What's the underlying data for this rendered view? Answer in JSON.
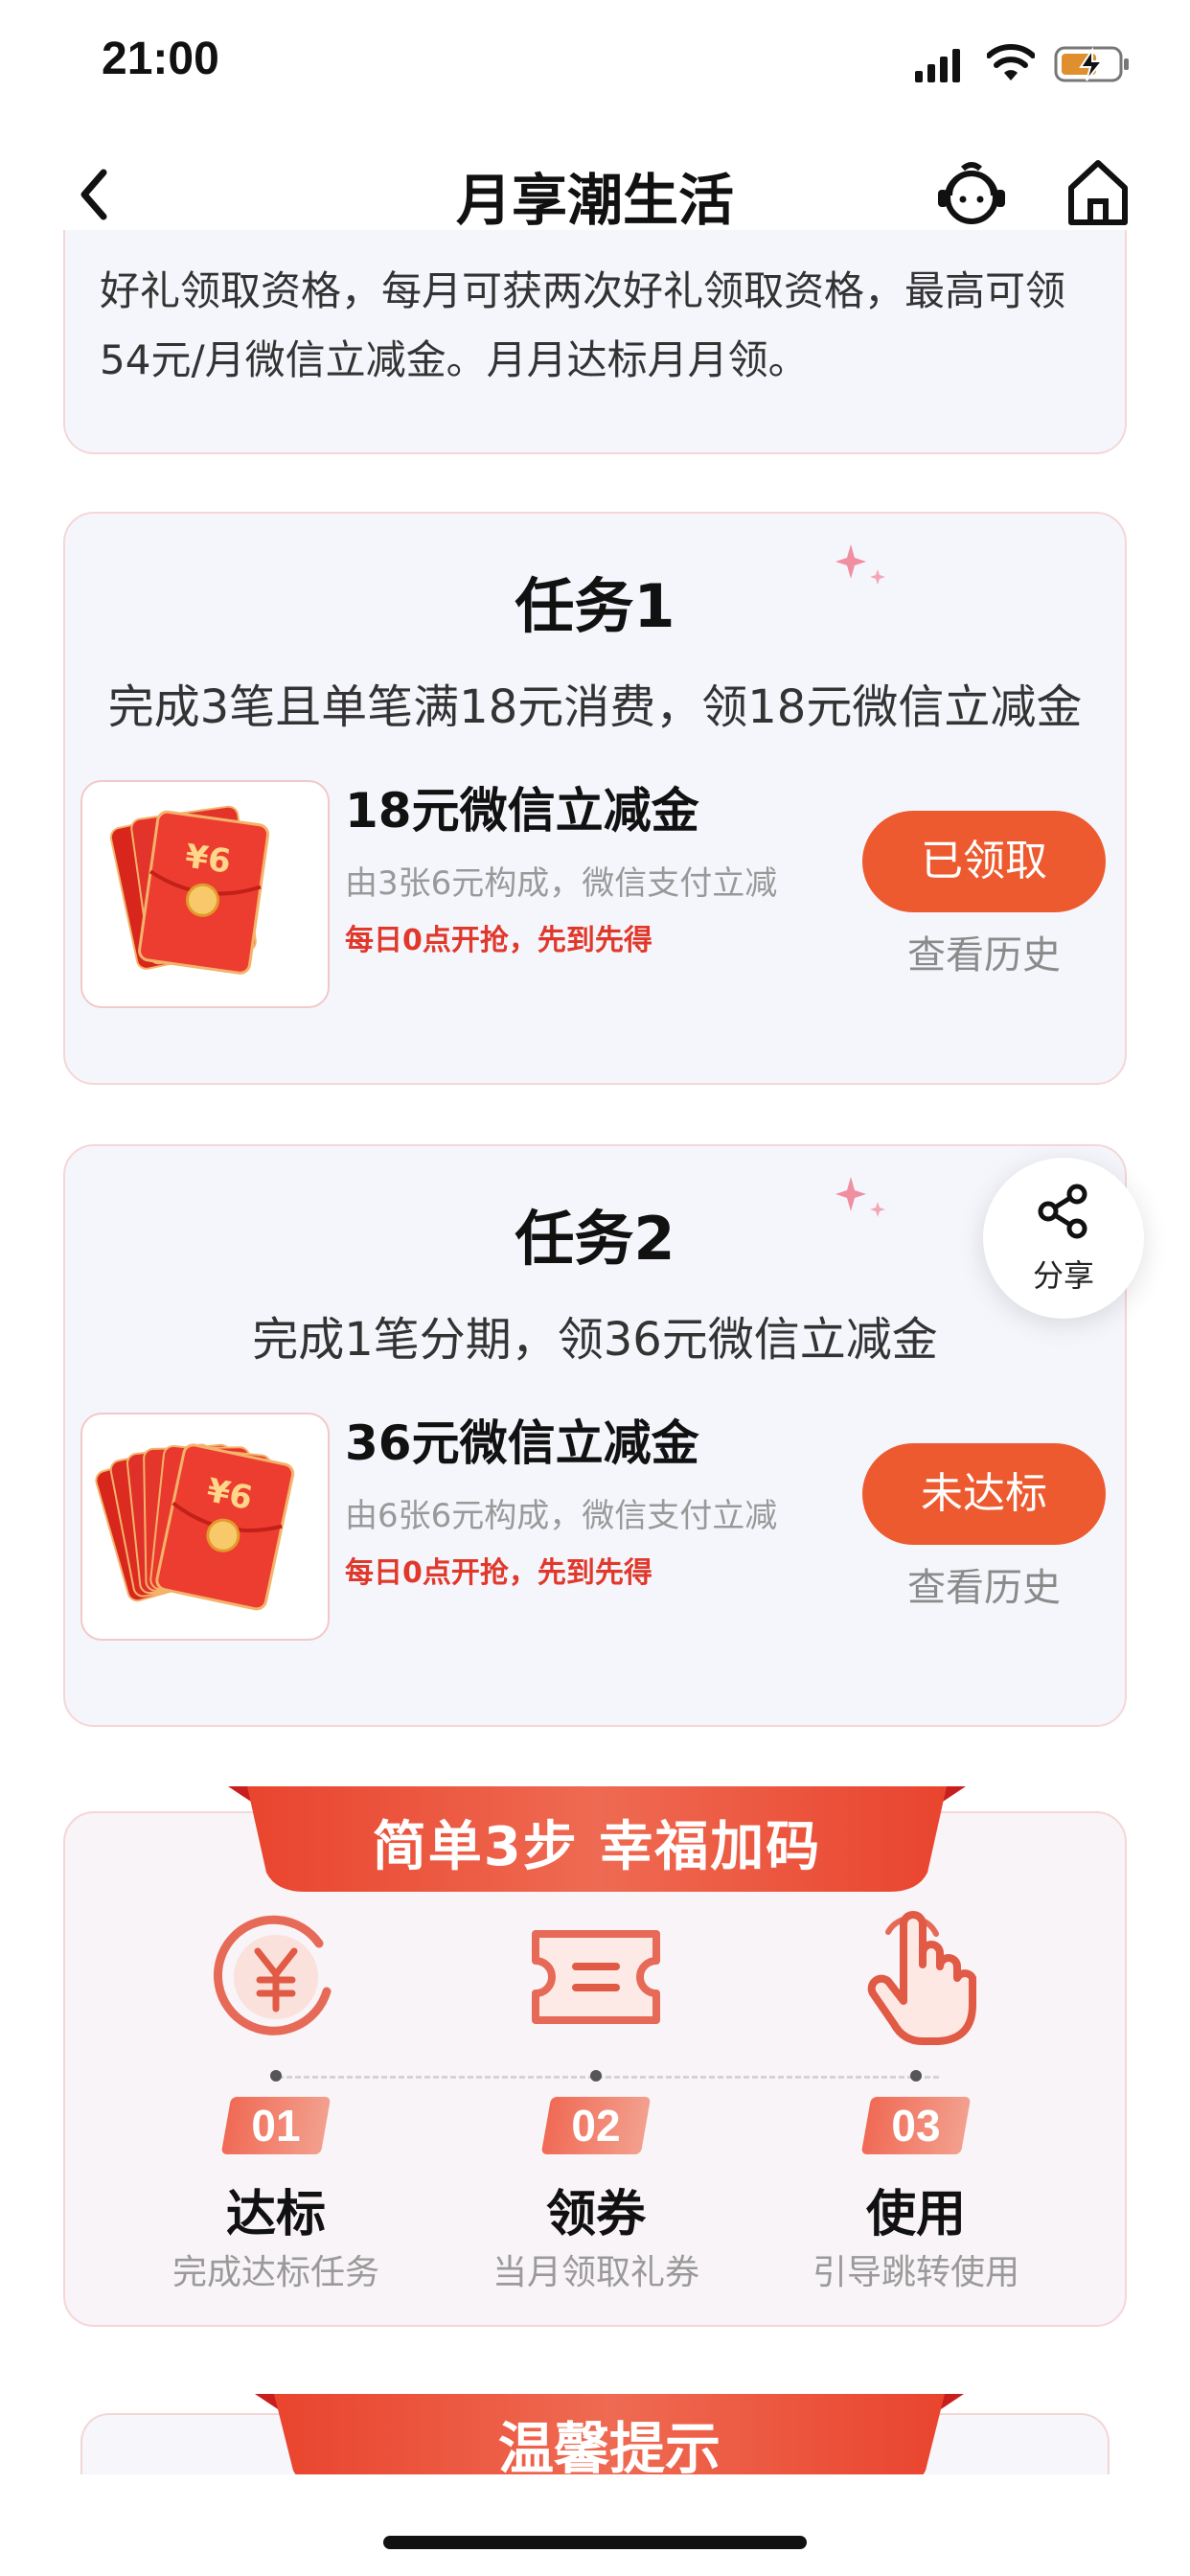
{
  "status_bar": {
    "time": "21:00"
  },
  "nav": {
    "title": "月享潮生活",
    "back_icon": "chevron-left-icon",
    "service_icon": "customer-service-icon",
    "home_icon": "home-icon"
  },
  "intro": {
    "text": "好礼领取资格，每月可获两次好礼领取资格，最高可领54元/月微信立减金。月月达标月月领。"
  },
  "tasks": [
    {
      "title": "任务1",
      "description": "完成3笔且单笔满18元消费，领18元微信立减金",
      "coupon_name": "18元微信立减金",
      "coupon_sub": "由3张6元构成，微信支付立减",
      "coupon_note": "每日0点开抢，先到先得",
      "coupon_face": "¥6",
      "coupon_count": 3,
      "action_label": "已领取",
      "history_label": "查看历史"
    },
    {
      "title": "任务2",
      "description": "完成1笔分期，领36元微信立减金",
      "coupon_name": "36元微信立减金",
      "coupon_sub": "由6张6元构成，微信支付立减",
      "coupon_note": "每日0点开抢，先到先得",
      "coupon_face": "¥6",
      "coupon_count": 6,
      "action_label": "未达标",
      "history_label": "查看历史"
    }
  ],
  "share": {
    "label": "分享"
  },
  "steps": {
    "title": "简单3步 幸福加码",
    "items": [
      {
        "num": "01",
        "title": "达标",
        "sub": "完成达标任务",
        "icon": "yen-coin-icon"
      },
      {
        "num": "02",
        "title": "领券",
        "sub": "当月领取礼券",
        "icon": "ticket-icon"
      },
      {
        "num": "03",
        "title": "使用",
        "sub": "引导跳转使用",
        "icon": "tap-hand-icon"
      }
    ]
  },
  "tips": {
    "title": "温馨提示"
  },
  "colors": {
    "accent": "#ee5a2f",
    "note_red": "#e0392c",
    "card_bg": "#f5f6fc",
    "card_border": "#f6d6d6"
  }
}
